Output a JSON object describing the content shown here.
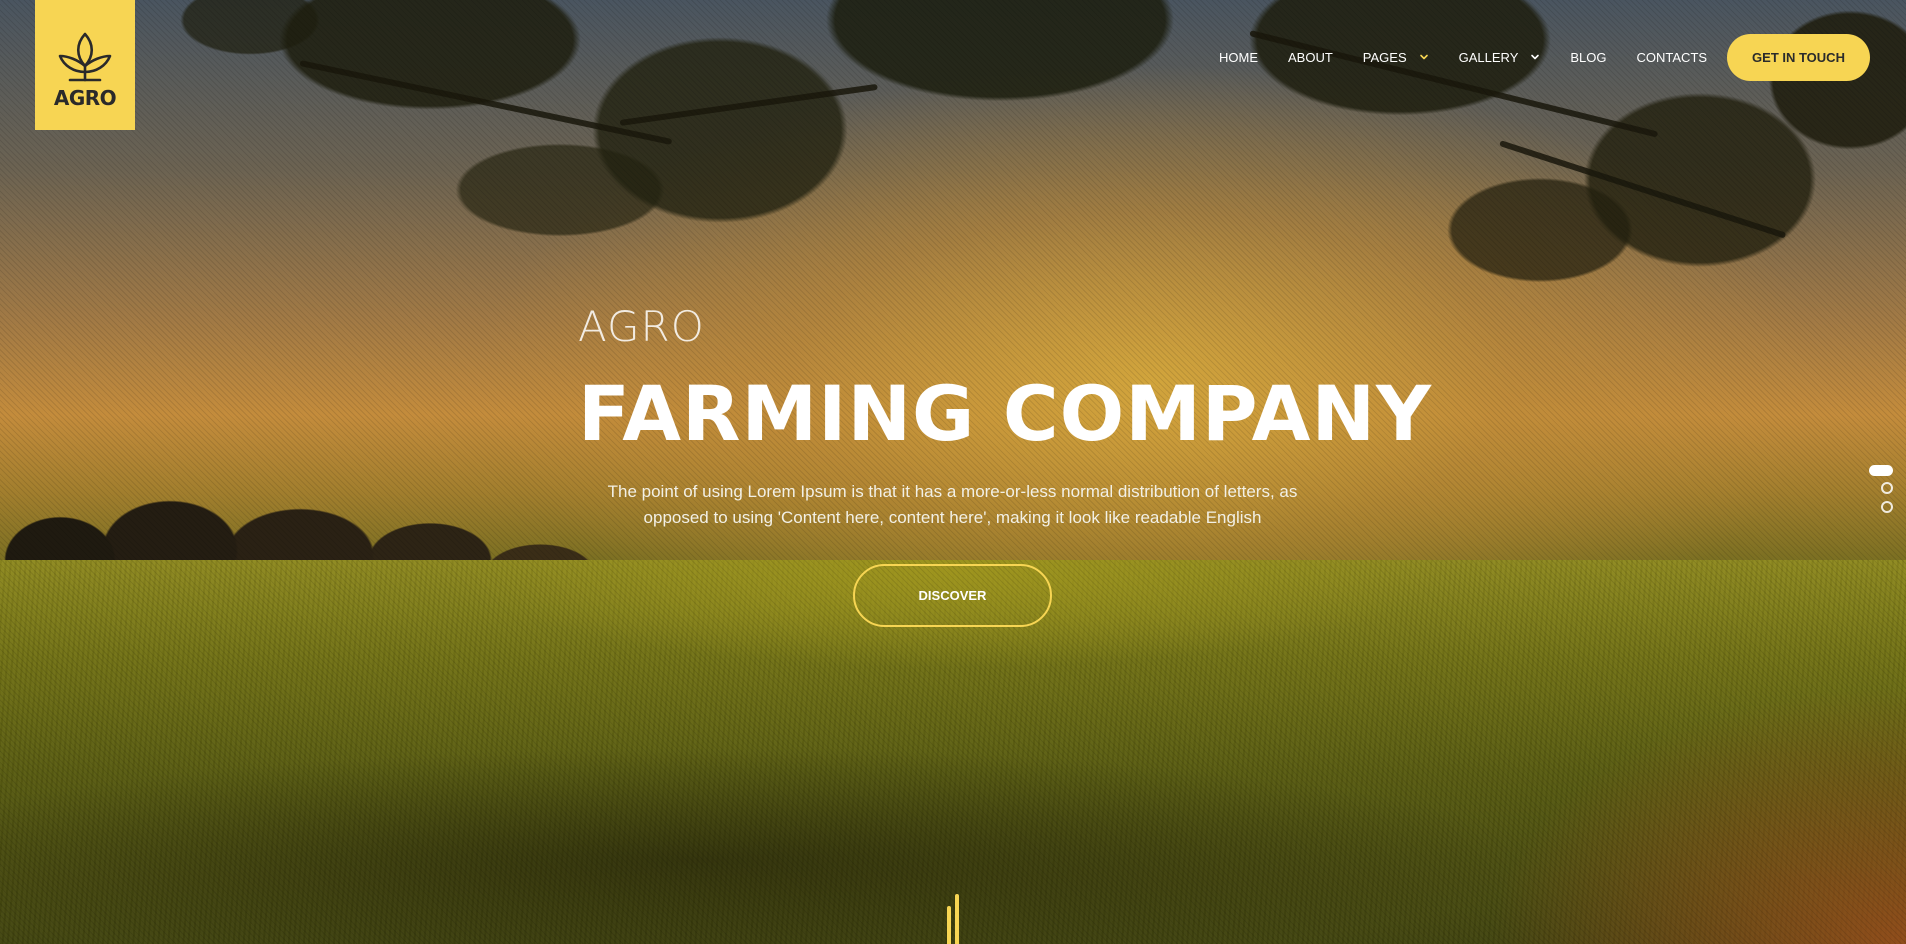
{
  "brand": {
    "logo_text": "AGRO",
    "logo_icon": "sprout-icon",
    "accent_color": "#f7d553"
  },
  "nav": {
    "items": [
      {
        "label": "HOME",
        "has_dropdown": false
      },
      {
        "label": "ABOUT",
        "has_dropdown": false
      },
      {
        "label": "PAGES",
        "has_dropdown": true
      },
      {
        "label": "GALLERY",
        "has_dropdown": true
      },
      {
        "label": "BLOG",
        "has_dropdown": false
      },
      {
        "label": "CONTACTS",
        "has_dropdown": false
      }
    ],
    "cta_label": "GET IN TOUCH"
  },
  "hero": {
    "eyebrow": "AGRO",
    "headline": "FARMING COMPANY",
    "lead": "The point of using Lorem Ipsum is that it has a more-or-less normal distribution of letters, as opposed to using 'Content here, content here', making it look like readable English",
    "button_label": "DISCOVER"
  },
  "slider": {
    "slide_count": 3,
    "active_index": 0
  }
}
